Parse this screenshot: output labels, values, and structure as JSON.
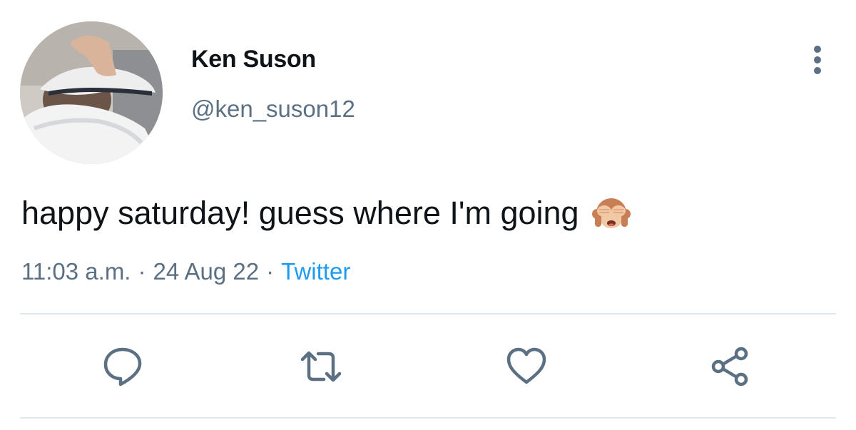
{
  "tweet": {
    "display_name": "Ken Suson",
    "handle": "@ken_suson12",
    "text": "happy saturday! guess where I'm going",
    "emoji": "see-no-evil-monkey-emoji",
    "time": "11:03 a.m.",
    "separator": "·",
    "date": "24 Aug 22",
    "source": "Twitter"
  },
  "icons": {
    "more": "more-options-icon",
    "reply": "reply-icon",
    "retweet": "retweet-icon",
    "like": "like-icon",
    "share": "share-icon"
  },
  "colors": {
    "text": "#0f1419",
    "secondary": "#5b7083",
    "link": "#1d9bf0",
    "divider": "#e1e8ed"
  }
}
